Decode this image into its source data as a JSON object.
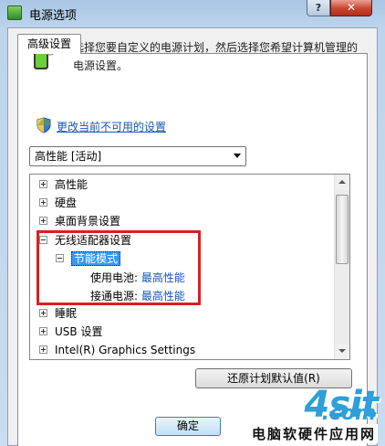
{
  "window": {
    "title": "电源选项",
    "help_label": "?",
    "close_label": "✕"
  },
  "tab": {
    "label": "高级设置"
  },
  "description": "选择您要自定义的电源计划，然后选择您希望计算机管理的电源设置。",
  "change_link": "更改当前不可用的设置",
  "plan_select": {
    "value": "高性能 [活动]"
  },
  "tree": {
    "items": [
      {
        "label": "高性能",
        "expander": "+"
      },
      {
        "label": "硬盘",
        "expander": "+"
      },
      {
        "label": "桌面背景设置",
        "expander": "+"
      },
      {
        "label": "无线适配器设置",
        "expander": "−"
      },
      {
        "label": "节能模式",
        "expander": "−"
      },
      {
        "label": "使用电池:",
        "value": "最高性能"
      },
      {
        "label": "接通电源:",
        "value": "最高性能"
      },
      {
        "label": "睡眠",
        "expander": "+"
      },
      {
        "label": "USB 设置",
        "expander": "+"
      },
      {
        "label": "Intel(R) Graphics Settings",
        "expander": "+"
      }
    ]
  },
  "buttons": {
    "restore": "还原计划默认值(R)",
    "ok": "确定"
  },
  "watermark": {
    "logo": "4sit",
    "tld": ".com",
    "subtitle": "电脑软硬件应用网"
  },
  "colors": {
    "link": "#1556b8",
    "selection": "#3399ff",
    "highlight_box": "#d82020",
    "watermark": "#2e9fd8"
  }
}
